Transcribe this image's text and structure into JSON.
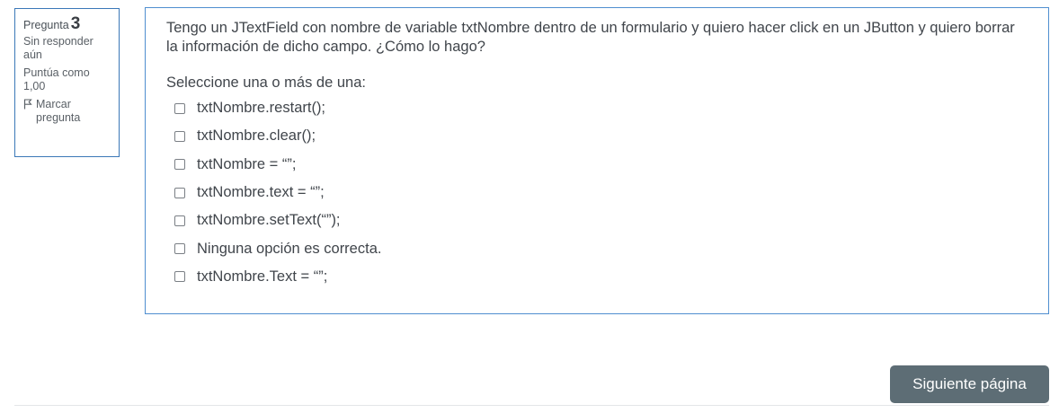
{
  "info": {
    "question_word": "Pregunta",
    "question_number": "3",
    "state": "Sin responder aún",
    "grade": "Puntúa como 1,00",
    "flag_label": "Marcar pregunta"
  },
  "question": {
    "text": "Tengo un JTextField con nombre de variable txtNombre dentro de un formulario y quiero hacer click en un JButton y quiero borrar la información de dicho campo. ¿Cómo lo hago?",
    "prompt": "Seleccione una o más de una:",
    "options": [
      "txtNombre.restart();",
      "txtNombre.clear();",
      "txtNombre = “”;",
      "txtNombre.text = “”;",
      "txtNombre.setText(“”);",
      "Ninguna opción es correcta.",
      "txtNombre.Text = “”;"
    ]
  },
  "navigation": {
    "next_label": "Siguiente página"
  },
  "icons": {
    "flag": "flag-icon"
  },
  "colors": {
    "info_border": "#3b78b8",
    "question_border": "#4f8ed0",
    "button_bg": "#5d6d75"
  }
}
